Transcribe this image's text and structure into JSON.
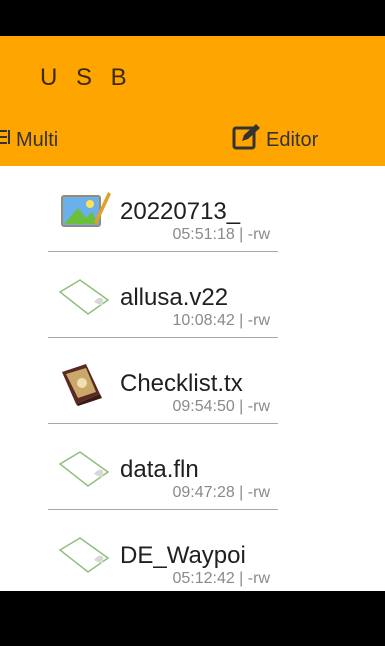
{
  "header": {
    "title": "U S B",
    "multi_label": "Multi",
    "editor_label": "Editor",
    "color": "#FFA500"
  },
  "files": [
    {
      "name": "20220713_",
      "meta": "05:51:18 | -rw",
      "icon": "image-file-icon"
    },
    {
      "name": "allusa.v22",
      "meta": "10:08:42 | -rw",
      "icon": "generic-file-icon"
    },
    {
      "name": "Checklist.tx",
      "meta": "09:54:50 | -rw",
      "icon": "text-document-icon"
    },
    {
      "name": "data.fln",
      "meta": "09:47:28 | -rw",
      "icon": "generic-file-icon"
    },
    {
      "name": "DE_Waypoi",
      "meta": "05:12:42 | -rw",
      "icon": "generic-file-icon"
    }
  ]
}
